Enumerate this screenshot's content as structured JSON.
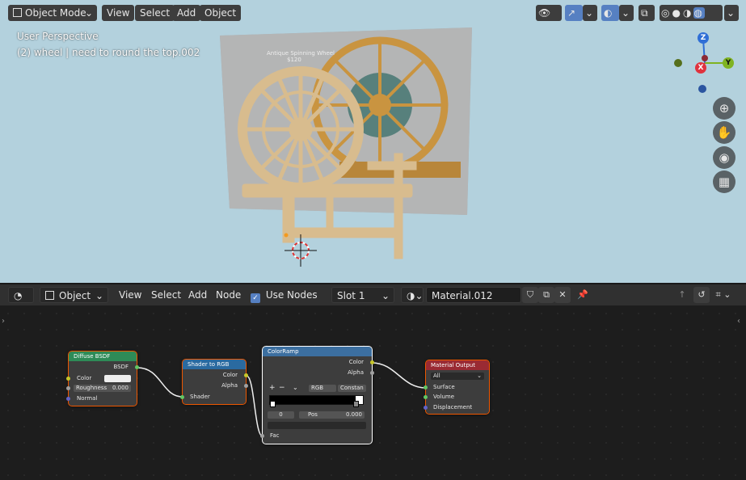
{
  "viewport": {
    "mode_label": "Object Mode",
    "menus": [
      "View",
      "Select",
      "Add",
      "Object"
    ],
    "overlay_line1": "User Perspective",
    "overlay_line2": "(2) wheel | need to round the top.002",
    "ref_image_text": "Antique Spinning Wheel",
    "ref_image_subtext": "$120",
    "axes": {
      "z": "Z",
      "y": "Y",
      "x": "X"
    },
    "nav_icons": [
      "zoom-icon",
      "hand-icon",
      "camera-icon",
      "grid-icon"
    ]
  },
  "node_header": {
    "editor_type": "Object",
    "menus": [
      "View",
      "Select",
      "Add",
      "Node"
    ],
    "use_nodes_label": "Use Nodes",
    "use_nodes_checked": true,
    "slot": "Slot 1",
    "material_name": "Material.012"
  },
  "nodes": {
    "diffuse": {
      "title": "Diffuse BSDF",
      "out_bsdf": "BSDF",
      "color_label": "Color",
      "roughness_label": "Roughness",
      "roughness_value": "0.000",
      "normal_label": "Normal",
      "header_color": "#2e8b57"
    },
    "shader_to_rgb": {
      "title": "Shader to RGB",
      "out_color": "Color",
      "out_alpha": "Alpha",
      "in_shader": "Shader",
      "header_color": "#2a6aa0"
    },
    "color_ramp": {
      "title": "ColorRamp",
      "out_color": "Color",
      "out_alpha": "Alpha",
      "mode": "RGB",
      "interp": "Constan",
      "index": "0",
      "pos_label": "Pos",
      "pos_value": "0.000",
      "in_fac": "Fac",
      "header_color": "#3c6fa0"
    },
    "material_output": {
      "title": "Material Output",
      "target": "All",
      "in_surface": "Surface",
      "in_volume": "Volume",
      "in_displacement": "Displacement",
      "header_color": "#9a2a33"
    }
  }
}
